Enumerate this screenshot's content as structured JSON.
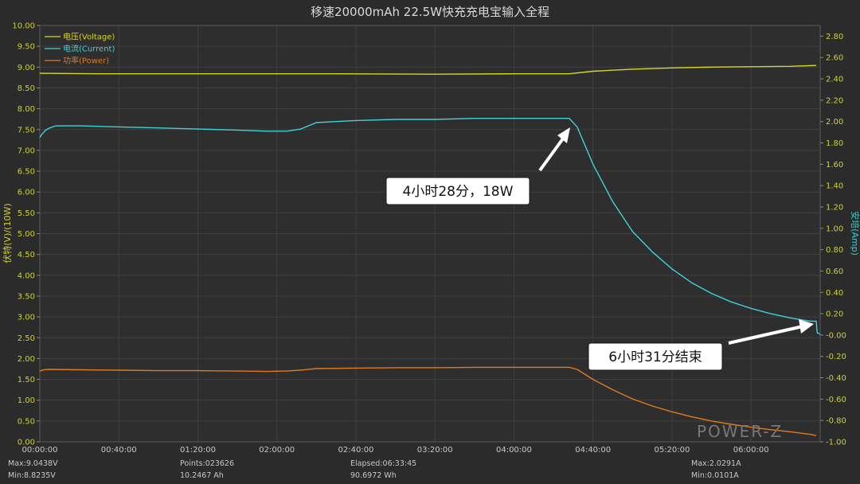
{
  "colors": {
    "background": "#2b2b2b",
    "plot_background": "#2e2e2e",
    "grid": "#404040",
    "voltage": "#d6d62a",
    "current": "#3fd2d8",
    "power": "#e07a1f",
    "left_axis": "#cfcf3a",
    "right_axis": "#3ec9cf"
  },
  "footer": {
    "max_v": "Max:9.0438V",
    "min_v": "Min:8.8235V",
    "points": "Points:023626",
    "capacity_ah": "10.2467 Ah",
    "elapsed": "Elapsed:06:33:45",
    "energy_wh": "90.6972 Wh",
    "max_a": "Max:2.0291A",
    "min_a": "Min:0.0101A"
  },
  "watermark": "POWER-Z",
  "annotations": [
    {
      "text": "4小时28分，18W"
    },
    {
      "text": "6小时31分结束"
    }
  ],
  "chart_data": {
    "type": "line",
    "title": "移速20000mAh 22.5W快充充电宝输入全程",
    "ylabel": "伏特(V)/(10W)",
    "y2label": "安培(Amp)",
    "xlabel": "",
    "xlim": [
      0,
      395
    ],
    "ylim": [
      0,
      10
    ],
    "y2lim": [
      -1.0,
      2.9
    ],
    "x_ticks": [
      "00:00:00",
      "00:40:00",
      "01:20:00",
      "02:00:00",
      "02:40:00",
      "03:20:00",
      "04:00:00",
      "04:40:00",
      "05:20:00",
      "06:00:00"
    ],
    "x_tick_minutes": [
      0,
      40,
      80,
      120,
      160,
      200,
      240,
      280,
      320,
      360
    ],
    "y_ticks": [
      "0.00",
      "0.50",
      "1.00",
      "1.50",
      "2.00",
      "2.50",
      "3.00",
      "3.50",
      "4.00",
      "4.50",
      "5.00",
      "5.50",
      "6.00",
      "6.50",
      "7.00",
      "7.50",
      "8.00",
      "8.50",
      "9.00",
      "9.50",
      "10.00"
    ],
    "y2_ticks": [
      "-1.00",
      "-0.80",
      "-0.60",
      "-0.40",
      "-0.20",
      "-0.00",
      "0.20",
      "0.40",
      "0.60",
      "0.80",
      "1.00",
      "1.20",
      "1.40",
      "1.60",
      "1.80",
      "2.00",
      "2.20",
      "2.40",
      "2.60",
      "2.80"
    ],
    "grid": true,
    "legend_position": "top-left",
    "series": [
      {
        "name": "电压(Voltage)",
        "axis": "left",
        "x": [
          0,
          30,
          60,
          100,
          150,
          200,
          240,
          268,
          280,
          300,
          320,
          340,
          360,
          380,
          393
        ],
        "values": [
          8.85,
          8.84,
          8.84,
          8.84,
          8.84,
          8.83,
          8.84,
          8.84,
          8.9,
          8.95,
          8.98,
          9.0,
          9.01,
          9.02,
          9.04
        ]
      },
      {
        "name": "电流(Current)",
        "axis": "right",
        "x": [
          0,
          1,
          3,
          5,
          8,
          20,
          40,
          60,
          80,
          100,
          115,
          125,
          132,
          140,
          150,
          160,
          180,
          200,
          220,
          240,
          255,
          268,
          272,
          280,
          290,
          300,
          310,
          320,
          330,
          340,
          350,
          360,
          370,
          380,
          390,
          393,
          393.5,
          395
        ],
        "values": [
          1.85,
          1.88,
          1.92,
          1.94,
          1.96,
          1.96,
          1.95,
          1.94,
          1.93,
          1.92,
          1.91,
          1.91,
          1.93,
          1.99,
          2.0,
          2.01,
          2.02,
          2.02,
          2.03,
          2.03,
          2.03,
          2.03,
          1.95,
          1.6,
          1.25,
          0.97,
          0.78,
          0.62,
          0.49,
          0.39,
          0.31,
          0.25,
          0.2,
          0.16,
          0.13,
          0.13,
          0.02,
          0.01
        ]
      },
      {
        "name": "功率(Power)",
        "axis": "left",
        "x": [
          0,
          2,
          5,
          20,
          40,
          60,
          80,
          100,
          115,
          125,
          132,
          140,
          160,
          180,
          200,
          220,
          240,
          255,
          268,
          272,
          280,
          290,
          300,
          310,
          320,
          330,
          340,
          350,
          360,
          370,
          380,
          390,
          393
        ],
        "values": [
          1.7,
          1.73,
          1.74,
          1.73,
          1.72,
          1.71,
          1.71,
          1.7,
          1.69,
          1.7,
          1.72,
          1.76,
          1.77,
          1.78,
          1.78,
          1.79,
          1.79,
          1.79,
          1.79,
          1.74,
          1.5,
          1.25,
          1.03,
          0.86,
          0.72,
          0.6,
          0.5,
          0.42,
          0.35,
          0.29,
          0.24,
          0.18,
          0.15
        ]
      }
    ]
  }
}
